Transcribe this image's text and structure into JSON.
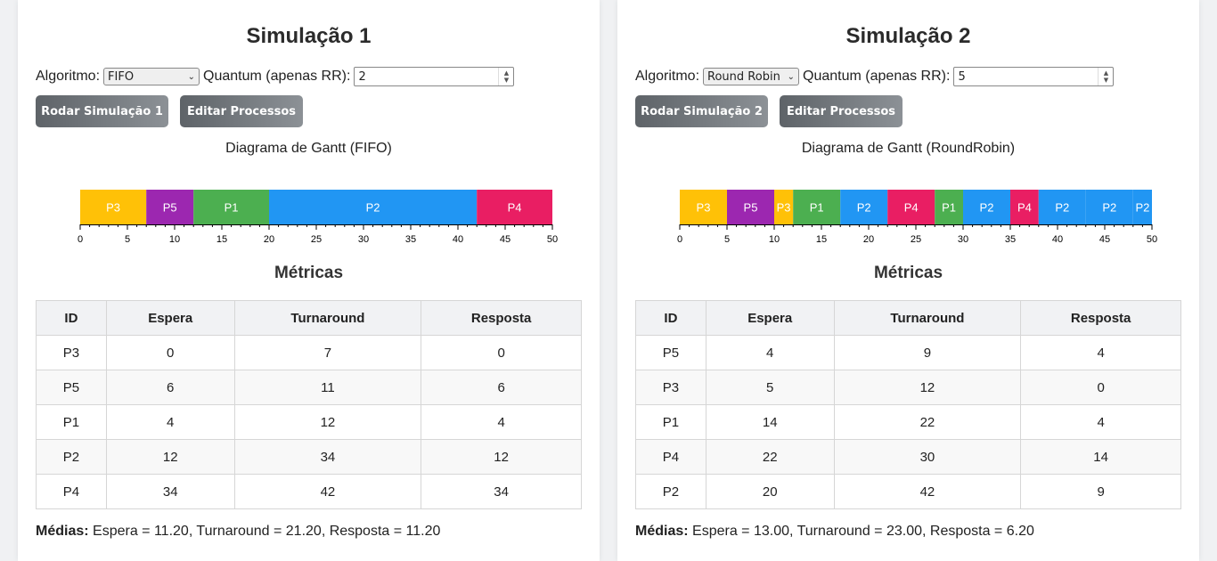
{
  "simulations": [
    {
      "title": "Simulação 1",
      "algorithm_label": "Algoritmo:",
      "algorithm_value": "FIFO",
      "quantum_label": "Quantum (apenas RR):",
      "quantum_value": "2",
      "run_button": "Rodar Simulação 1",
      "edit_button": "Editar Processos",
      "gantt_title": "Diagrama de Gantt (FIFO)",
      "metrics_title": "Métricas",
      "table_headers": [
        "ID",
        "Espera",
        "Turnaround",
        "Resposta"
      ],
      "table_rows": [
        [
          "P3",
          "0",
          "7",
          "0"
        ],
        [
          "P5",
          "6",
          "11",
          "6"
        ],
        [
          "P1",
          "4",
          "12",
          "4"
        ],
        [
          "P2",
          "12",
          "34",
          "12"
        ],
        [
          "P4",
          "34",
          "42",
          "34"
        ]
      ],
      "averages_label": "Médias:",
      "averages_text": "Espera = 11.20, Turnaround = 21.20, Resposta = 11.20"
    },
    {
      "title": "Simulação 2",
      "algorithm_label": "Algoritmo:",
      "algorithm_value": "Round Robin",
      "quantum_label": "Quantum (apenas RR):",
      "quantum_value": "5",
      "run_button": "Rodar Simulação 2",
      "edit_button": "Editar Processos",
      "gantt_title": "Diagrama de Gantt (RoundRobin)",
      "metrics_title": "Métricas",
      "table_headers": [
        "ID",
        "Espera",
        "Turnaround",
        "Resposta"
      ],
      "table_rows": [
        [
          "P5",
          "4",
          "9",
          "4"
        ],
        [
          "P3",
          "5",
          "12",
          "0"
        ],
        [
          "P1",
          "14",
          "22",
          "4"
        ],
        [
          "P4",
          "22",
          "30",
          "14"
        ],
        [
          "P2",
          "20",
          "42",
          "9"
        ]
      ],
      "averages_label": "Médias:",
      "averages_text": "Espera = 13.00, Turnaround = 23.00, Resposta = 6.20"
    }
  ],
  "process_colors": {
    "P1": "#4caf50",
    "P2": "#2196f3",
    "P3": "#ffc107",
    "P4": "#e91e63",
    "P5": "#9c27b0"
  },
  "chart_data": [
    {
      "type": "gantt",
      "title": "Diagrama de Gantt (FIFO)",
      "xlim": [
        0,
        50
      ],
      "ticks": [
        0,
        5,
        10,
        15,
        20,
        25,
        30,
        35,
        40,
        45,
        50
      ],
      "segments": [
        {
          "process": "P3",
          "start": 0,
          "end": 7
        },
        {
          "process": "P5",
          "start": 7,
          "end": 12
        },
        {
          "process": "P1",
          "start": 12,
          "end": 20
        },
        {
          "process": "P2",
          "start": 20,
          "end": 42
        },
        {
          "process": "P4",
          "start": 42,
          "end": 50
        }
      ]
    },
    {
      "type": "gantt",
      "title": "Diagrama de Gantt (RoundRobin)",
      "xlim": [
        0,
        50
      ],
      "ticks": [
        0,
        5,
        10,
        15,
        20,
        25,
        30,
        35,
        40,
        45,
        50
      ],
      "segments": [
        {
          "process": "P3",
          "start": 0,
          "end": 5
        },
        {
          "process": "P5",
          "start": 5,
          "end": 10
        },
        {
          "process": "P3",
          "start": 10,
          "end": 12
        },
        {
          "process": "P1",
          "start": 12,
          "end": 17
        },
        {
          "process": "P2",
          "start": 17,
          "end": 22
        },
        {
          "process": "P4",
          "start": 22,
          "end": 27
        },
        {
          "process": "P1",
          "start": 27,
          "end": 30
        },
        {
          "process": "P2",
          "start": 30,
          "end": 35
        },
        {
          "process": "P4",
          "start": 35,
          "end": 38
        },
        {
          "process": "P2",
          "start": 38,
          "end": 43
        },
        {
          "process": "P2",
          "start": 43,
          "end": 48
        },
        {
          "process": "P2",
          "start": 48,
          "end": 50
        }
      ]
    }
  ]
}
